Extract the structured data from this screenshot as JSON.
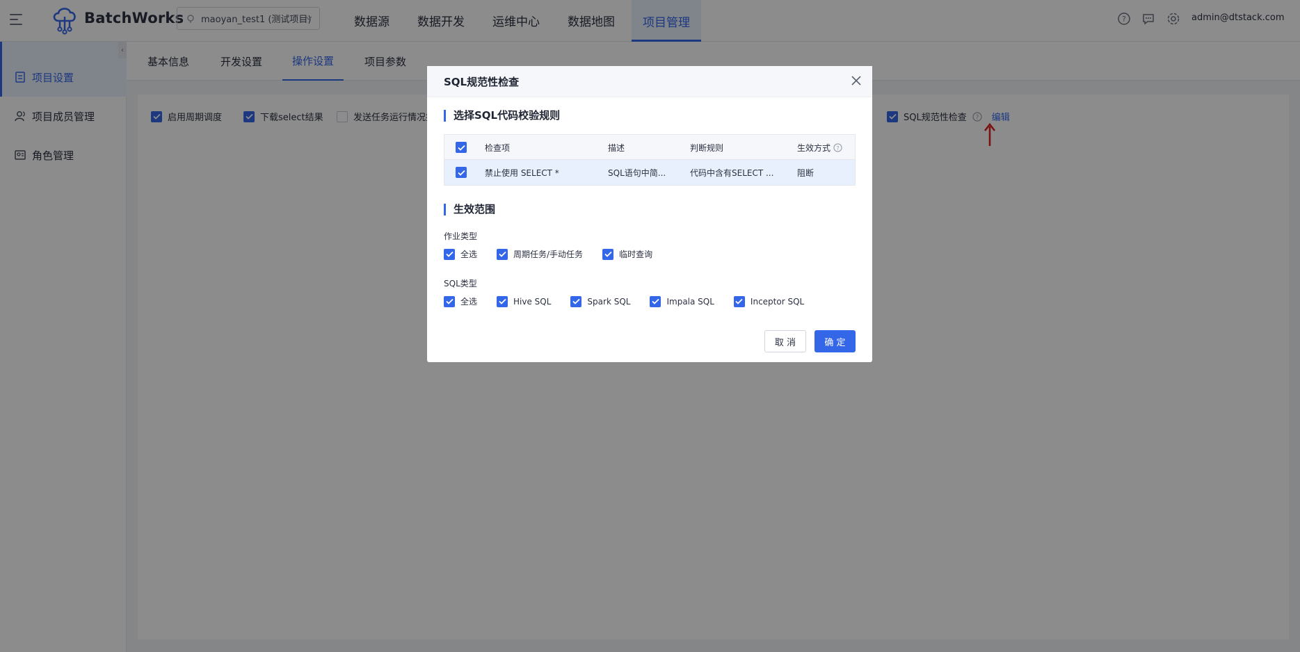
{
  "header": {
    "brand": "BatchWorks",
    "project": "maoyan_test1 (测试项目)",
    "nav": [
      "数据源",
      "数据开发",
      "运维中心",
      "数据地图",
      "项目管理"
    ],
    "active_nav": "项目管理",
    "user": "admin@dtstack.com",
    "icons": [
      "help-icon",
      "message-icon",
      "gear-icon"
    ]
  },
  "sidebar": {
    "items": [
      {
        "label": "项目设置",
        "icon": "project-settings-icon",
        "active": true
      },
      {
        "label": "项目成员管理",
        "icon": "members-icon",
        "active": false
      },
      {
        "label": "角色管理",
        "icon": "role-icon",
        "active": false
      }
    ]
  },
  "tabs": [
    "基本信息",
    "开发设置",
    "操作设置",
    "项目参数"
  ],
  "active_tab": "操作设置",
  "options": [
    {
      "label": "启用周期调度",
      "checked": true
    },
    {
      "label": "下载select结果",
      "checked": true
    },
    {
      "label": "发送任务运行情况报",
      "checked": false
    },
    {
      "label": "SQL规范性检查",
      "checked": true
    }
  ],
  "edit_link": "编辑",
  "modal": {
    "title": "SQL规范性检查",
    "section1": "选择SQL代码校验规则",
    "table": {
      "columns": [
        "检查项",
        "描述",
        "判断规则",
        "生效方式"
      ],
      "rows": [
        {
          "item": "禁止使用 SELECT *",
          "desc": "SQL语句中简...",
          "rule": "代码中含有SELECT ...",
          "mode": "阻断",
          "checked": true
        }
      ]
    },
    "section2": "生效范围",
    "job_type_label": "作业类型",
    "job_types": [
      "全选",
      "周期任务/手动任务",
      "临时查询"
    ],
    "sql_type_label": "SQL类型",
    "sql_types": [
      "全选",
      "Hive SQL",
      "Spark SQL",
      "Impala SQL",
      "Inceptor SQL"
    ],
    "cancel": "取 消",
    "ok": "确 定"
  },
  "colors": {
    "accent": "#3466e8",
    "arrow": "#e02020"
  }
}
